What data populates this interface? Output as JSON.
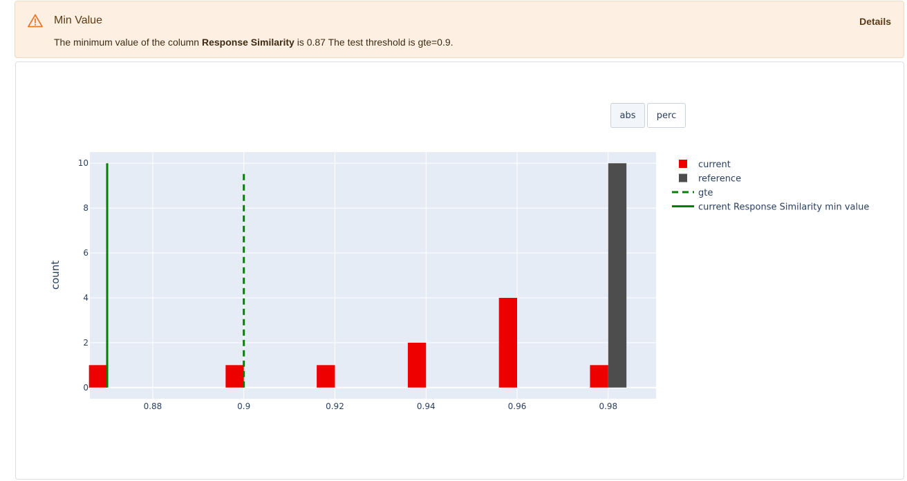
{
  "alert": {
    "icon": "warning-triangle-icon",
    "title": "Min Value",
    "details_label": "Details",
    "message_prefix": "The minimum value of the column",
    "column": "Response Similarity",
    "message_suffix": "is 0.87 The test threshold is gte=0.9.",
    "color": "#e8772e"
  },
  "toggles": {
    "abs": "abs",
    "perc": "perc"
  },
  "chart_data": {
    "type": "bar",
    "ylabel": "count",
    "xlabel": "",
    "x_ticks": [
      0.88,
      0.9,
      0.92,
      0.94,
      0.96,
      0.98
    ],
    "y_ticks": [
      0,
      2,
      4,
      6,
      8,
      10
    ],
    "xlim": [
      0.8662,
      0.9905
    ],
    "ylim": [
      -0.5,
      10.5
    ],
    "series": [
      {
        "name": "current",
        "color": "#ee0000",
        "x": [
          0.87,
          0.88,
          0.89,
          0.9,
          0.91,
          0.92,
          0.93,
          0.94,
          0.95,
          0.96,
          0.97,
          0.98
        ],
        "values": [
          1,
          0,
          0,
          1,
          0,
          1,
          0,
          2,
          0,
          4,
          0,
          1
        ]
      },
      {
        "name": "reference",
        "color": "#4d4d4d",
        "x": [
          0.87,
          0.88,
          0.89,
          0.9,
          0.91,
          0.92,
          0.93,
          0.94,
          0.95,
          0.96,
          0.97,
          0.98
        ],
        "values": [
          0,
          0,
          0,
          0,
          0,
          0,
          0,
          0,
          0,
          0,
          0,
          10
        ]
      }
    ],
    "lines": [
      {
        "name": "gte",
        "x": 0.9,
        "style": "dash",
        "color": "#008000",
        "y_range": [
          0,
          9.7
        ]
      },
      {
        "name": "current Response Similarity min value",
        "x": 0.87,
        "style": "solid",
        "color": "#008000",
        "y_range": [
          0,
          10
        ]
      }
    ],
    "legend_position": "right",
    "grid": true
  }
}
